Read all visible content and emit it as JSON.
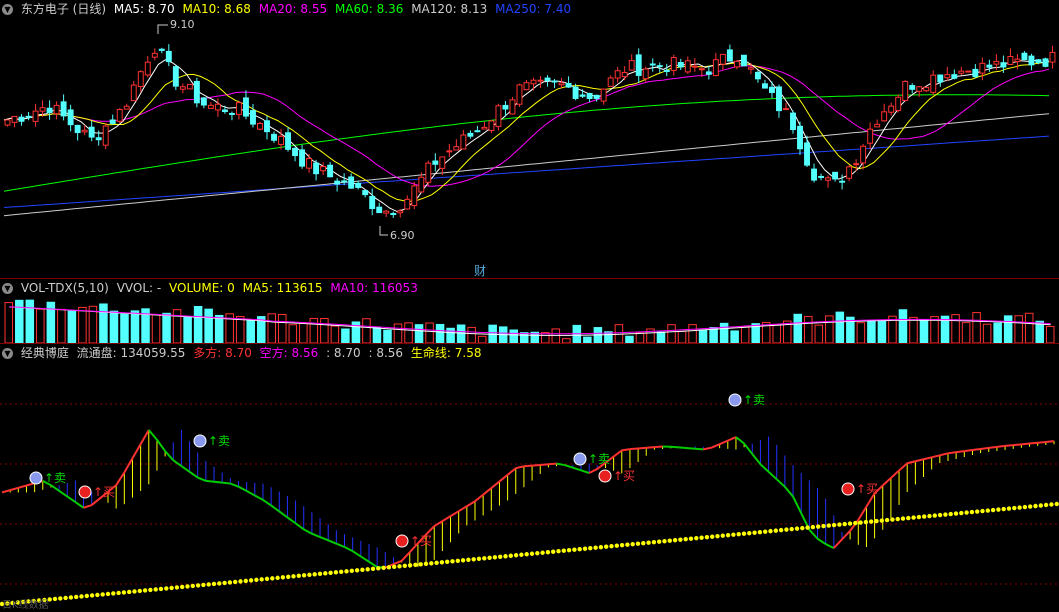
{
  "kline": {
    "title": "东方电子 (日线)",
    "ma": [
      {
        "label": "MA5: 8.70",
        "color": "#ffffff"
      },
      {
        "label": "MA10: 8.68",
        "color": "#ffff00"
      },
      {
        "label": "MA20: 8.55",
        "color": "#ff00ff"
      },
      {
        "label": "MA60: 8.36",
        "color": "#00ff00"
      },
      {
        "label": "MA120: 8.13",
        "color": "#cccccc"
      },
      {
        "label": "MA250: 7.40",
        "color": "#2244ff"
      }
    ],
    "high_label": "9.10",
    "low_label": "6.90",
    "fin_badge": "财"
  },
  "volume": {
    "title": "VOL-TDX(5,10)",
    "vvol": "VVOL: -",
    "volume": "VOLUME: 0",
    "ma5": "MA5: 113615",
    "ma10": "MA10: 116053"
  },
  "game": {
    "title": "经典博庭",
    "float_shares": "流通盘: 134059.55",
    "long_label": "多方: 8.70",
    "short_label": "空方: 8.56",
    "v1": ": 8.70",
    "v2": ": 8.56",
    "life_line": "生命线: 7.58",
    "buy_text": "买",
    "sell_text": "卖"
  },
  "footer": "日K线数据",
  "colors": {
    "up": "#ff3232",
    "down": "#54ffff",
    "ma5": "#ffffff",
    "ma10": "#ffff00",
    "ma20": "#ff00ff",
    "ma60": "#00ff00",
    "ma120": "#cccccc",
    "ma250": "#2244ff",
    "bull_fill": "#ffff00",
    "bear_fill": "#2233ff",
    "life": "#ffff00"
  },
  "chart_data": [
    {
      "type": "candlestick",
      "title": "东方电子 (日线)",
      "ylim": [
        6.9,
        9.1
      ],
      "annotations": [
        "9.10",
        "6.90"
      ]
    },
    {
      "type": "bar",
      "title": "VOL-TDX(5,10)",
      "series": [
        {
          "name": "MA5",
          "last": 113615
        },
        {
          "name": "MA10",
          "last": 116053
        }
      ]
    },
    {
      "type": "line",
      "title": "经典博庭",
      "series": [
        {
          "name": "多方",
          "last": 8.7
        },
        {
          "name": "空方",
          "last": 8.56
        },
        {
          "name": "生命线",
          "last": 7.58
        }
      ]
    }
  ]
}
